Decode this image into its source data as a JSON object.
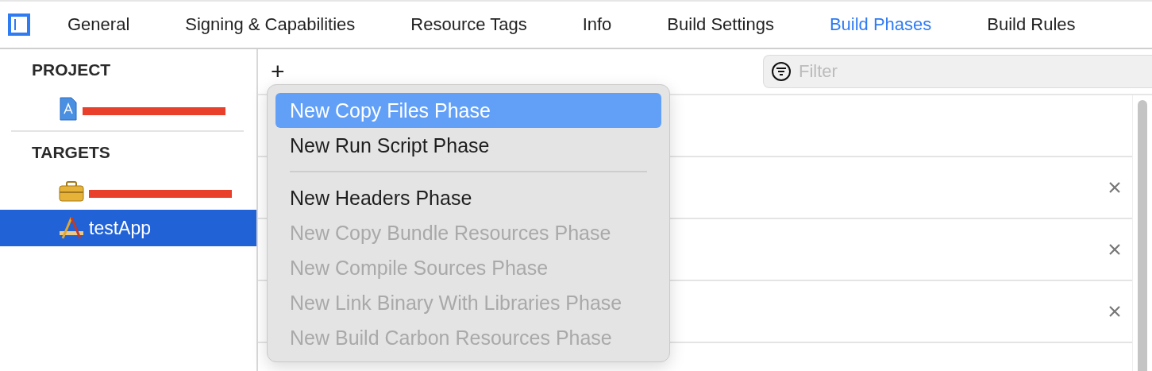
{
  "tabs": [
    {
      "label": "General",
      "selected": false
    },
    {
      "label": "Signing & Capabilities",
      "selected": false
    },
    {
      "label": "Resource Tags",
      "selected": false
    },
    {
      "label": "Info",
      "selected": false
    },
    {
      "label": "Build Settings",
      "selected": false
    },
    {
      "label": "Build Phases",
      "selected": true
    },
    {
      "label": "Build Rules",
      "selected": false
    }
  ],
  "sidebar": {
    "sections": [
      {
        "title": "PROJECT",
        "items": [
          {
            "kind": "project",
            "redacted": true,
            "selected": false
          }
        ]
      },
      {
        "title": "TARGETS",
        "items": [
          {
            "kind": "framework",
            "redacted": true,
            "selected": false
          },
          {
            "kind": "app",
            "label": "testApp",
            "redacted": false,
            "selected": true
          }
        ]
      }
    ]
  },
  "toolbar": {
    "add": "+",
    "filter": {
      "placeholder": "Filter"
    }
  },
  "phases": [
    {
      "removable": false
    },
    {
      "removable": true
    },
    {
      "removable": true
    },
    {
      "removable": true
    }
  ],
  "menu": {
    "groups": [
      [
        {
          "label": "New Copy Files Phase",
          "selected": true,
          "disabled": false
        },
        {
          "label": "New Run Script Phase",
          "selected": false,
          "disabled": false
        }
      ],
      [
        {
          "label": "New Headers Phase",
          "selected": false,
          "disabled": false
        },
        {
          "label": "New Copy Bundle Resources Phase",
          "selected": false,
          "disabled": true
        },
        {
          "label": "New Compile Sources Phase",
          "selected": false,
          "disabled": true
        },
        {
          "label": "New Link Binary With Libraries Phase",
          "selected": false,
          "disabled": true
        },
        {
          "label": "New Build Carbon Resources Phase",
          "selected": false,
          "disabled": true
        }
      ]
    ]
  }
}
